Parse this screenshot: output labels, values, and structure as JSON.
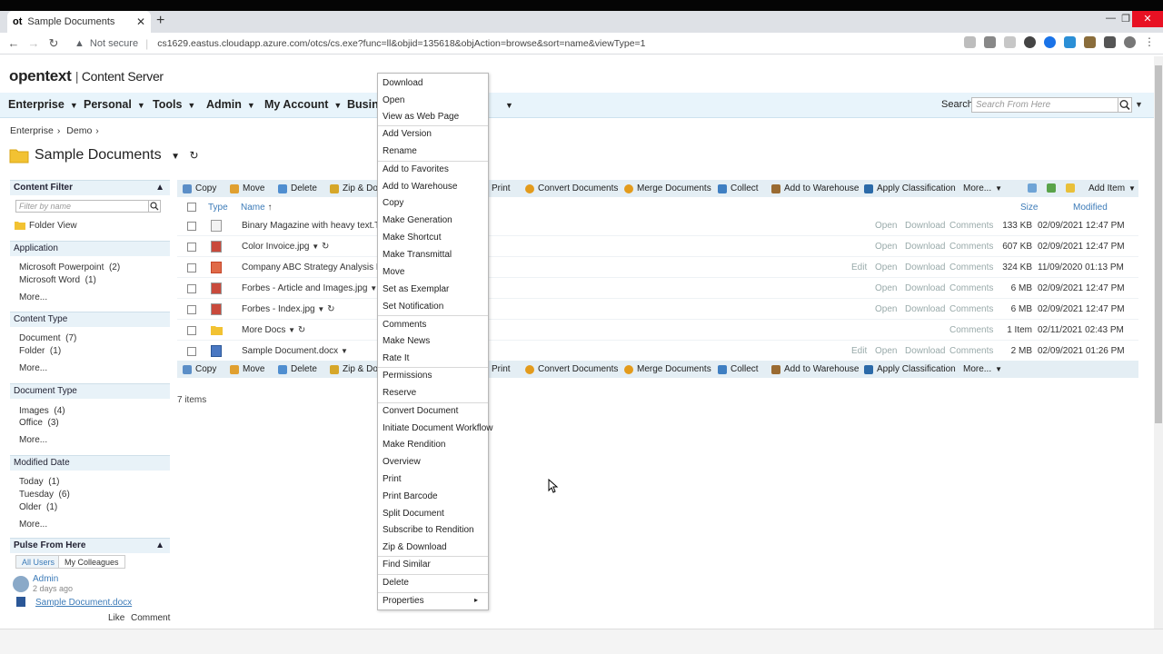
{
  "browser": {
    "tab_icon": "ot",
    "tab_title": "Sample Documents",
    "security_label": "Not secure",
    "url": "cs1629.eastus.cloudapp.azure.com/otcs/cs.exe?func=ll&objid=135618&objAction=browse&sort=name&viewType=1"
  },
  "app": {
    "logo": "opentext",
    "product": "Content Server",
    "nav": [
      "Enterprise",
      "Personal",
      "Tools",
      "Admin",
      "My Account",
      "Busine"
    ],
    "search_label": "Search",
    "search_placeholder": "Search From Here",
    "breadcrumb": [
      "Enterprise",
      "Demo"
    ],
    "page_title": "Sample Documents"
  },
  "left_pane": {
    "content_filter": "Content Filter",
    "filter_placeholder": "Filter by name",
    "folder_view": "Folder View",
    "application": "Application",
    "app_items": [
      {
        "label": "Microsoft Powerpoint",
        "count": "(2)"
      },
      {
        "label": "Microsoft Word",
        "count": "(1)"
      }
    ],
    "content_type": "Content Type",
    "content_items": [
      {
        "label": "Document",
        "count": "(7)"
      },
      {
        "label": "Folder",
        "count": "(1)"
      }
    ],
    "document_type": "Document Type",
    "doc_items": [
      {
        "label": "Images",
        "count": "(4)"
      },
      {
        "label": "Office",
        "count": "(3)"
      }
    ],
    "modified_date": "Modified Date",
    "date_items": [
      {
        "label": "Today",
        "count": "(1)"
      },
      {
        "label": "Tuesday",
        "count": "(6)"
      },
      {
        "label": "Older",
        "count": "(1)"
      }
    ],
    "more": "More...",
    "pulse": "Pulse From Here",
    "all_users": "All Users",
    "my_colleagues": "My Colleagues",
    "pulse_user": "Admin",
    "pulse_time": "2 days ago",
    "pulse_doc": "Sample Document.docx",
    "like": "Like",
    "comment": "Comment"
  },
  "toolbar": {
    "copy": "Copy",
    "move": "Move",
    "delete": "Delete",
    "zip": "Zip & Dov",
    "print": "Print",
    "convert": "Convert Documents",
    "merge": "Merge Documents",
    "collect": "Collect",
    "add_warehouse": "Add to Warehouse",
    "apply_class": "Apply Classification",
    "more": "More...",
    "add_item": "Add Item"
  },
  "table": {
    "headers": {
      "type": "Type",
      "name": "Name",
      "size": "Size",
      "modified": "Modified"
    },
    "rows": [
      {
        "name": "Binary Magazine with heavy text.TIF",
        "edit": "",
        "open": "Open",
        "download": "Download",
        "comments": "Comments",
        "size": "133 KB",
        "modified": "02/09/2021 12:47 PM"
      },
      {
        "name": "Color Invoice.jpg",
        "edit": "",
        "open": "Open",
        "download": "Download",
        "comments": "Comments",
        "size": "607 KB",
        "modified": "02/09/2021 12:47 PM"
      },
      {
        "name": "Company ABC Strategy Analysis Revi",
        "edit": "Edit",
        "open": "Open",
        "download": "Download",
        "comments": "Comments",
        "size": "324 KB",
        "modified": "11/09/2020 01:13 PM"
      },
      {
        "name": "Forbes - Article and Images.jpg",
        "edit": "",
        "open": "Open",
        "download": "Download",
        "comments": "Comments",
        "size": "6 MB",
        "modified": "02/09/2021 12:47 PM"
      },
      {
        "name": "Forbes - Index.jpg",
        "edit": "",
        "open": "Open",
        "download": "Download",
        "comments": "Comments",
        "size": "6 MB",
        "modified": "02/09/2021 12:47 PM"
      },
      {
        "name": "More Docs",
        "edit": "",
        "open": "",
        "download": "",
        "comments": "Comments",
        "size": "1 Item",
        "modified": "02/11/2021 02:43 PM"
      },
      {
        "name": "Sample Document.docx",
        "edit": "Edit",
        "open": "Open",
        "download": "Download",
        "comments": "Comments",
        "size": "2 MB",
        "modified": "02/09/2021 01:26 PM"
      }
    ],
    "items_count": "7 items"
  },
  "context_menu": [
    "Download",
    "Open",
    "View as Web Page",
    "Add Version",
    "Rename",
    "Add to Favorites",
    "Add to Warehouse",
    "Copy",
    "Make Generation",
    "Make Shortcut",
    "Make Transmittal",
    "Move",
    "Set as Exemplar",
    "Set Notification",
    "Comments",
    "Make News",
    "Rate It",
    "Permissions",
    "Reserve",
    "Convert Document",
    "Initiate Document Workflow",
    "Make Rendition",
    "Overview",
    "Print",
    "Print Barcode",
    "Split Document",
    "Subscribe to Rendition",
    "Zip & Download",
    "Find Similar",
    "Delete",
    "Properties"
  ]
}
